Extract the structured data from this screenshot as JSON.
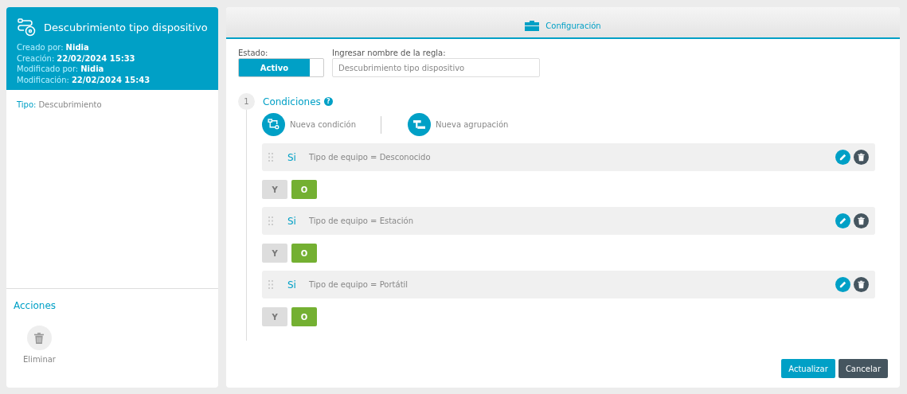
{
  "rule_card": {
    "title": "Descubrimiento tipo dispositivo",
    "meta": [
      {
        "label": "Creado por:",
        "value": "Nidia"
      },
      {
        "label": "Creación:",
        "value": "22/02/2024 15:33"
      },
      {
        "label": "Modificado por:",
        "value": "Nidia"
      },
      {
        "label": "Modificación:",
        "value": "22/02/2024 15:43"
      }
    ],
    "type": {
      "label": "Tipo:",
      "value": "Descubrimiento"
    }
  },
  "actions": {
    "title": "Acciones",
    "items": [
      {
        "label": "Eliminar"
      }
    ]
  },
  "tabs": [
    {
      "label": "Configuración",
      "selected": true
    }
  ],
  "status": {
    "label": "Estado:",
    "value": "Activo",
    "on": true
  },
  "rule_name": {
    "label": "Ingresar nombre de la regla:",
    "value": "Descubrimiento tipo dispositivo"
  },
  "conditions": {
    "step": "1",
    "title": "Condiciones",
    "help": "?",
    "add_buttons": [
      {
        "kind": "condition",
        "label": "Nueva condición"
      },
      {
        "kind": "group",
        "label": "Nueva agrupación"
      }
    ],
    "items": [
      {
        "prefix": "Si",
        "text": "Tipo de equipo = Desconocido",
        "connectors": [
          {
            "label": "Y",
            "selected": false
          },
          {
            "label": "O",
            "selected": true
          }
        ]
      },
      {
        "prefix": "Si",
        "text": "Tipo de equipo = Estación",
        "connectors": [
          {
            "label": "Y",
            "selected": false
          },
          {
            "label": "O",
            "selected": true
          }
        ]
      },
      {
        "prefix": "Si",
        "text": "Tipo de equipo = Portátil",
        "connectors": [
          {
            "label": "Y",
            "selected": false
          },
          {
            "label": "O",
            "selected": true
          }
        ]
      }
    ]
  },
  "buttons": [
    {
      "kind": "primary",
      "label": "Actualizar"
    },
    {
      "kind": "secondary",
      "label": "Cancelar"
    }
  ]
}
